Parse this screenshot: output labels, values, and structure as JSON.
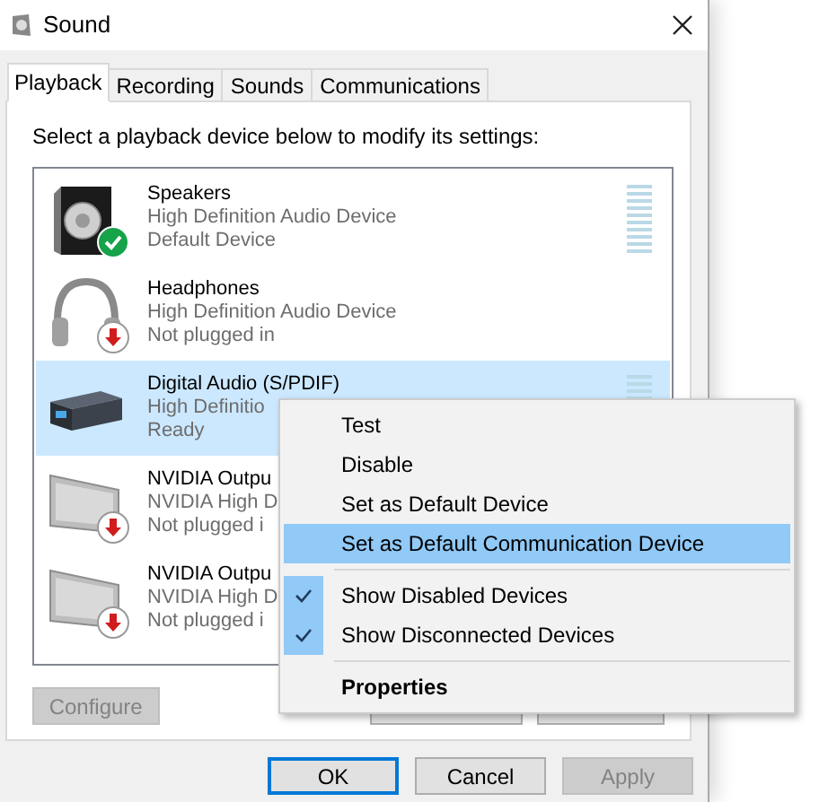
{
  "window": {
    "title": "Sound"
  },
  "tabs": [
    {
      "label": "Playback",
      "selected": true
    },
    {
      "label": "Recording",
      "selected": false
    },
    {
      "label": "Sounds",
      "selected": false
    },
    {
      "label": "Communications",
      "selected": false
    }
  ],
  "instruction": "Select a playback device below to modify its settings:",
  "devices": [
    {
      "kind": "speaker",
      "is_default": true,
      "unplugged": false,
      "name": "Speakers",
      "driver": "High Definition Audio Device",
      "status": "Default Device",
      "selected": false,
      "meter": true
    },
    {
      "kind": "headphones",
      "is_default": false,
      "unplugged": true,
      "name": "Headphones",
      "driver": "High Definition Audio Device",
      "status": "Not plugged in",
      "selected": false,
      "meter": false
    },
    {
      "kind": "receiver",
      "is_default": false,
      "unplugged": false,
      "name": "Digital Audio (S/PDIF)",
      "driver": "High Definitio",
      "status": "Ready",
      "selected": true,
      "meter": true
    },
    {
      "kind": "monitor",
      "is_default": false,
      "unplugged": true,
      "name": "NVIDIA Outpu",
      "driver": "NVIDIA High D",
      "status": "Not plugged i",
      "selected": false,
      "meter": false
    },
    {
      "kind": "monitor",
      "is_default": false,
      "unplugged": true,
      "name": "NVIDIA Outpu",
      "driver": "NVIDIA High D",
      "status": "Not plugged i",
      "selected": false,
      "meter": false
    }
  ],
  "configure_button": {
    "label": "Configure",
    "disabled": true
  },
  "dialog_buttons": [
    {
      "label": "OK",
      "disabled": false,
      "focused": true
    },
    {
      "label": "Cancel",
      "disabled": false,
      "focused": false
    },
    {
      "label": "Apply",
      "disabled": true,
      "focused": false
    }
  ],
  "context_menu": [
    {
      "kind": "item",
      "label": "Test",
      "selected": false
    },
    {
      "kind": "item",
      "label": "Disable",
      "selected": false
    },
    {
      "kind": "item",
      "label": "Set as Default Device",
      "selected": false
    },
    {
      "kind": "item",
      "label": "Set as Default Communication Device",
      "selected": true
    },
    {
      "kind": "separator"
    },
    {
      "kind": "check",
      "label": "Show Disabled Devices",
      "checked": true,
      "selected": false
    },
    {
      "kind": "check",
      "label": "Show Disconnected Devices",
      "checked": true,
      "selected": false
    },
    {
      "kind": "separator"
    },
    {
      "kind": "bold",
      "label": "Properties",
      "selected": false
    }
  ]
}
